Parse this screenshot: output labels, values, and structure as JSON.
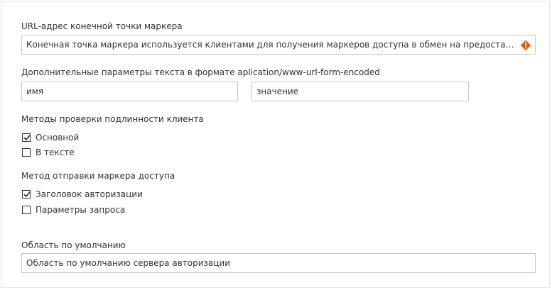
{
  "token_endpoint": {
    "label": "URL-адрес конечной точки маркера",
    "value": "Конечная точка маркера используется клиентами для получения маркеров доступа в обмен на предоставление прав...",
    "warning_icon": "warning-icon",
    "warning_color": "#e8590c"
  },
  "body_params": {
    "label": "Дополнительные параметры текста в формате aplication/www-url-form-encoded",
    "name_placeholder": "имя",
    "value_placeholder": "значение"
  },
  "client_auth": {
    "label": "Методы проверки подлинности клиента",
    "options": [
      {
        "label": "Основной",
        "checked": true
      },
      {
        "label": "В тексте",
        "checked": false
      }
    ]
  },
  "token_send": {
    "label": "Метод отправки маркера доступа",
    "options": [
      {
        "label": "Заголовок авторизации",
        "checked": true
      },
      {
        "label": "Параметры запроса",
        "checked": false
      }
    ]
  },
  "default_scope": {
    "label": "Область по умолчанию",
    "value": "Область по умолчанию сервера авторизации"
  }
}
